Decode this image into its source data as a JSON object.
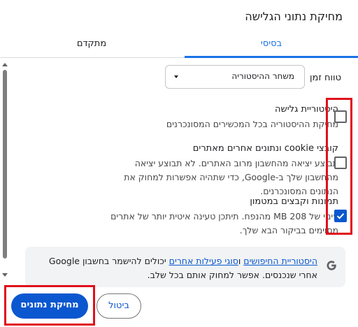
{
  "dialog": {
    "title": "מחיקת נתוני הגלישה"
  },
  "tabs": [
    {
      "label": "בסיסי",
      "selected": true
    },
    {
      "label": "מתקדם",
      "selected": false
    }
  ],
  "time_range": {
    "label": "טווח זמן",
    "value": "משחר ההיסטוריה"
  },
  "items": [
    {
      "title": "היסטוריית גלישה",
      "desc": "מחיקת ההיסטוריה בכל המכשירים המסונכרנים",
      "checked": false
    },
    {
      "title": "קובצי cookie ונתונים אחרים מאתרים",
      "desc": "תבוצע יציאה מהחשבון מרוב האתרים. לא תבוצע יציאה מהחשבון שלך ב-Google, כדי שתהיה אפשרות למחוק את הנתונים המסונכרנים.",
      "checked": false
    },
    {
      "title": "תמונות וקבצים במטמון",
      "desc": "פינוי של MB 208 מהנפח. תיתכן טעינה איטית יותר של אתרים מסוימים בביקור הבא שלך.",
      "checked": true
    }
  ],
  "google_notice": {
    "link_searches": "היסטוריית החיפושים",
    "and": " ו",
    "link_activity": "סוגי פעילות אחרים",
    "rest": " יכולים להישמר בחשבון Google אחרי שנכנסים. אפשר למחוק אותם בכל שלב."
  },
  "buttons": {
    "cancel": "ביטול",
    "clear": "מחיקת נתונים"
  },
  "colors": {
    "accent": "#0b57d0",
    "highlight": "#e0101c"
  }
}
